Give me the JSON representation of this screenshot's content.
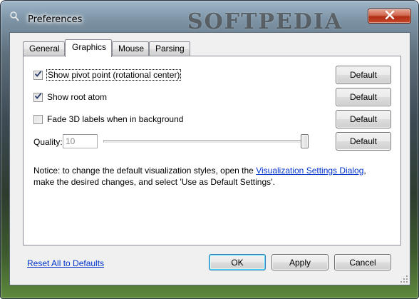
{
  "window": {
    "title": "Preferences",
    "watermark": "SOFTPEDIA",
    "close_label": "✕"
  },
  "tabs": [
    {
      "label": "General",
      "active": false
    },
    {
      "label": "Graphics",
      "active": true
    },
    {
      "label": "Mouse",
      "active": false
    },
    {
      "label": "Parsing",
      "active": false
    }
  ],
  "options": {
    "pivot": {
      "label": "Show pivot point (rotational center)",
      "checked": true
    },
    "root_atom": {
      "label": "Show root atom",
      "checked": true
    },
    "fade_labels": {
      "label": "Fade 3D labels when in background",
      "checked": false
    }
  },
  "default_button_label": "Default",
  "quality": {
    "label": "Quality:",
    "value": "10",
    "slider_fraction": 1.0
  },
  "notice": {
    "prefix": "Notice: to change the default visualization styles, open the ",
    "link": "Visualization Settings Dialog",
    "suffix": ", make the desired changes, and select 'Use as Default Settings'."
  },
  "footer": {
    "reset_link": "Reset All to Defaults",
    "ok_label": "OK",
    "apply_label": "Apply",
    "cancel_label": "Cancel"
  },
  "colors": {
    "link": "#0033cc",
    "close_button": "#c8482a",
    "focus_border": "#3c7fb1"
  },
  "icons": {
    "app": "pin-icon",
    "close": "close-icon",
    "check": "check-icon",
    "grip": "resize-grip-icon"
  }
}
